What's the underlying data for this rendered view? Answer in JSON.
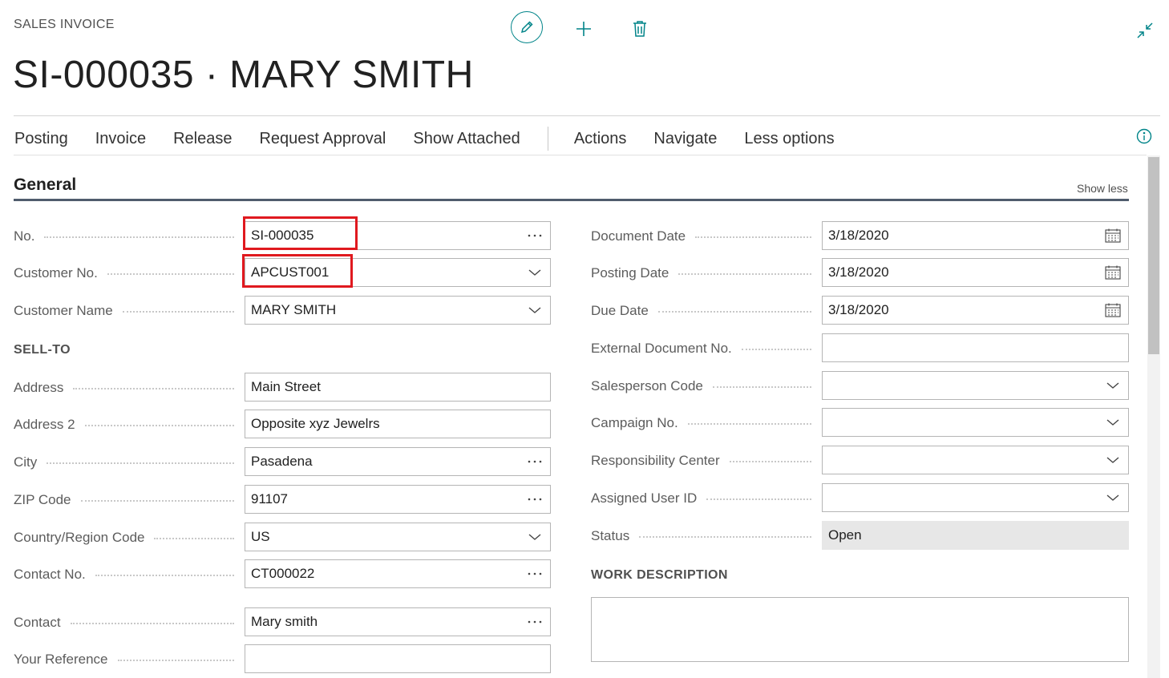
{
  "header": {
    "caption": "SALES INVOICE",
    "title": "SI-000035 · MARY SMITH"
  },
  "menu": {
    "items": [
      "Posting",
      "Invoice",
      "Release",
      "Request Approval",
      "Show Attached"
    ],
    "items2": [
      "Actions",
      "Navigate",
      "Less options"
    ]
  },
  "group": {
    "title": "General",
    "toggle": "Show less"
  },
  "left": {
    "no": {
      "label": "No.",
      "value": "SI-000035"
    },
    "customer_no": {
      "label": "Customer No.",
      "value": "APCUST001"
    },
    "customer_name": {
      "label": "Customer Name",
      "value": "MARY SMITH"
    },
    "sell_to_heading": "SELL-TO",
    "address": {
      "label": "Address",
      "value": "Main Street"
    },
    "address2": {
      "label": "Address 2",
      "value": "Opposite xyz Jewelrs"
    },
    "city": {
      "label": "City",
      "value": "Pasadena"
    },
    "zip": {
      "label": "ZIP Code",
      "value": "91107"
    },
    "country": {
      "label": "Country/Region Code",
      "value": "US"
    },
    "contact_no": {
      "label": "Contact No.",
      "value": "CT000022"
    },
    "contact": {
      "label": "Contact",
      "value": "Mary smith"
    },
    "your_reference": {
      "label": "Your Reference",
      "value": ""
    }
  },
  "right": {
    "document_date": {
      "label": "Document Date",
      "value": "3/18/2020"
    },
    "posting_date": {
      "label": "Posting Date",
      "value": "3/18/2020"
    },
    "due_date": {
      "label": "Due Date",
      "value": "3/18/2020"
    },
    "external_doc_no": {
      "label": "External Document No.",
      "value": ""
    },
    "salesperson_code": {
      "label": "Salesperson Code",
      "value": ""
    },
    "campaign_no": {
      "label": "Campaign No.",
      "value": ""
    },
    "responsibility_center": {
      "label": "Responsibility Center",
      "value": ""
    },
    "assigned_user_id": {
      "label": "Assigned User ID",
      "value": ""
    },
    "status": {
      "label": "Status",
      "value": "Open"
    },
    "work_description_heading": "WORK DESCRIPTION"
  },
  "colors": {
    "accent": "#008489",
    "highlight": "#e0191f"
  },
  "icons": {
    "edit": "pencil-icon",
    "add": "plus-icon",
    "delete": "trash-icon",
    "collapse": "collapse-arrows-icon",
    "info": "info-icon",
    "lookup": "ellipsis-icon",
    "dropdown": "chevron-down-icon",
    "date": "calendar-icon"
  }
}
